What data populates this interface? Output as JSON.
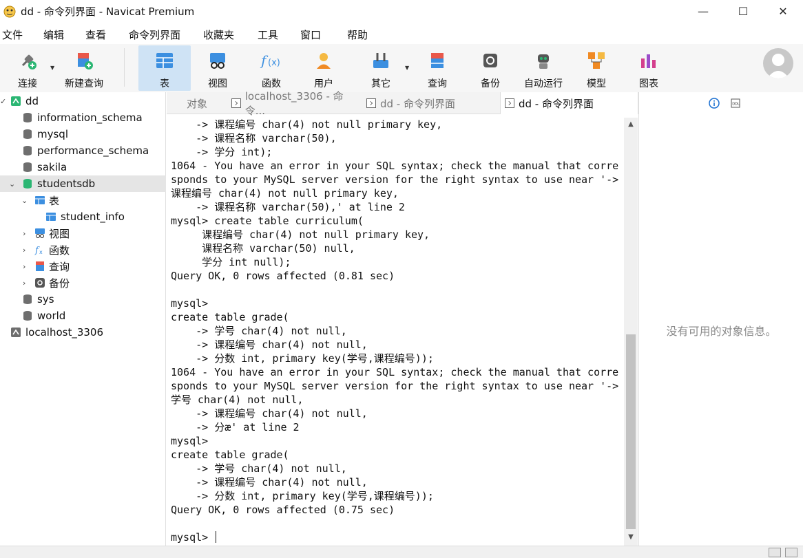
{
  "window": {
    "title": "dd - 命令列界面 - Navicat Premium",
    "minimize_glyph": "—",
    "maximize_glyph": "☐",
    "close_glyph": "✕"
  },
  "menu": [
    "文件",
    "编辑",
    "查看",
    "命令列界面",
    "收藏夹",
    "工具",
    "窗口",
    "帮助"
  ],
  "toolbar": {
    "connect": "连接",
    "new_query": "新建查询",
    "table": "表",
    "view": "视图",
    "function": "函数",
    "user": "用户",
    "other": "其它",
    "query": "查询",
    "backup": "备份",
    "automation": "自动运行",
    "model": "模型",
    "chart": "图表"
  },
  "sidebar": {
    "connection": "dd",
    "databases": [
      "information_schema",
      "mysql",
      "performance_schema",
      "sakila",
      "studentsdb"
    ],
    "tables_label": "表",
    "table_item": "student_info",
    "views_label": "视图",
    "functions_label": "函数",
    "queries_label": "查询",
    "backups_label": "备份",
    "db_after": [
      "sys",
      "world"
    ],
    "other_connection": "localhost_3306"
  },
  "tabs": {
    "objects": "对象",
    "tab1": "localhost_3306 - 命令...",
    "tab2": "dd - 命令列界面",
    "tab3": "dd - 命令列界面"
  },
  "console": {
    "lines": [
      "    -> 课程编号 char(4) not null primary key,",
      "    -> 课程名称 varchar(50),",
      "    -> 学分 int);",
      "1064 - You have an error in your SQL syntax; check the manual that corre",
      "sponds to your MySQL server version for the right syntax to use near '->",
      "课程编号 char(4) not null primary key,",
      "    -> 课程名称 varchar(50),' at line 2",
      "mysql> create table curriculum(",
      "     课程编号 char(4) not null primary key,",
      "     课程名称 varchar(50) null,",
      "     学分 int null);",
      "Query OK, 0 rows affected (0.81 sec)",
      "",
      "mysql>",
      "create table grade(",
      "    -> 学号 char(4) not null,",
      "    -> 课程编号 char(4) not null,",
      "    -> 分数 int, primary key(学号,课程编号));",
      "1064 - You have an error in your SQL syntax; check the manual that corre",
      "sponds to your MySQL server version for the right syntax to use near '->",
      "学号 char(4) not null,",
      "    -> 课程编号 char(4) not null,",
      "    -> 分æ' at line 2",
      "mysql>",
      "create table grade(",
      "    -> 学号 char(4) not null,",
      "    -> 课程编号 char(4) not null,",
      "    -> 分数 int, primary key(学号,课程编号));",
      "Query OK, 0 rows affected (0.75 sec)",
      ""
    ],
    "prompt": "mysql> "
  },
  "info_panel": {
    "empty_text": "没有可用的对象信息。"
  },
  "colors": {
    "accent_active": "#cfe3f5",
    "db_green": "#2bb673",
    "db_gray": "#6e6e6e",
    "table_blue": "#3c8fe0"
  }
}
